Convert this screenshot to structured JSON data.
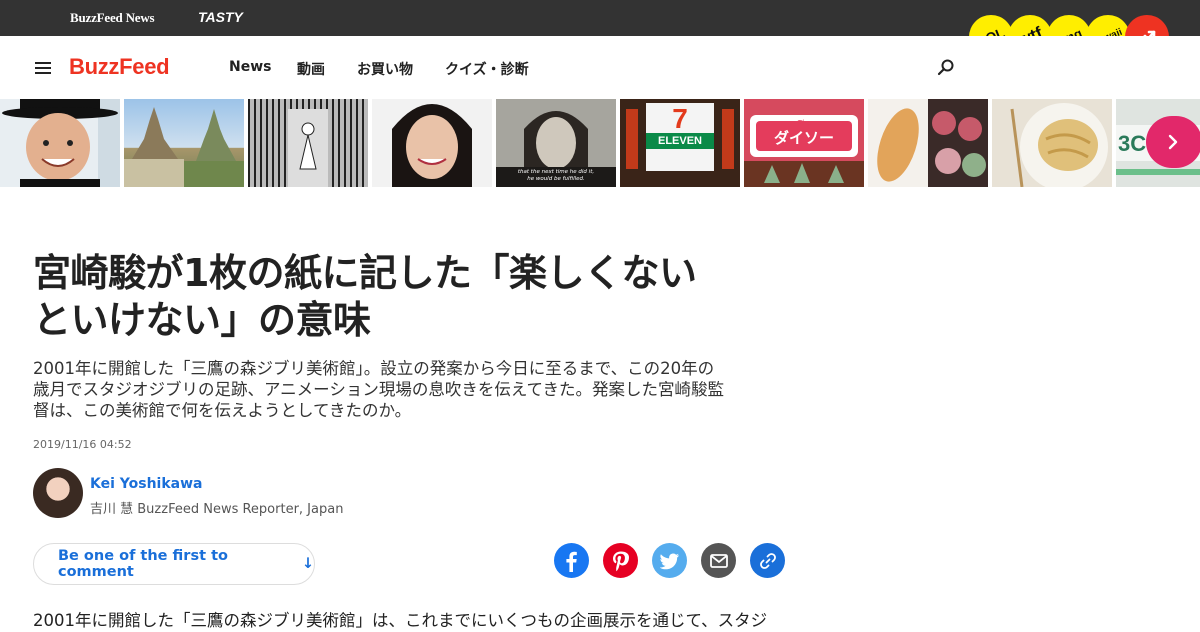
{
  "topbar": {
    "brand_primary": "BuzzFeed News",
    "brand_secondary": "TASTY"
  },
  "reactions": [
    {
      "label": "LOL"
    },
    {
      "label": "wtf"
    },
    {
      "label": "omg"
    },
    {
      "label": "kawaii"
    }
  ],
  "reaction_icons": {
    "trending": "trending-up-icon"
  },
  "nav": {
    "logo": "BuzzFeed",
    "links": [
      "News",
      "動画",
      "お買い物",
      "クイズ・診断"
    ],
    "menu_icon": "hamburger-icon",
    "search_icon": "search-icon"
  },
  "thumbnails": {
    "t5_caption_1": "that the next time he did it,",
    "t5_caption_2": "he would be fulfilled.",
    "t6_sign": "ELEVEN",
    "t6_number": "7",
    "t7_small": "The",
    "t7_sign": "ダイソー",
    "t10_text": "3CO"
  },
  "article": {
    "headline_line1": "宮崎駿が1枚の紙に記した「楽しくない",
    "headline_line2": "といけない」の意味",
    "dek_line1": "2001年に開館した「三鷹の森ジブリ美術館」。設立の発案から今日に至るまで、この20年の",
    "dek_line2": "歳月でスタジオジブリの足跡、アニメーション現場の息吹きを伝えてきた。発案した宮崎駿監",
    "dek_line3": "督は、この美術館で何を伝えようとしてきたのか。",
    "timestamp": "2019/11/16 04:52",
    "author_name": "Kei Yoshikawa",
    "author_role": "吉川 慧 BuzzFeed News Reporter, Japan",
    "comment_label": "Be one of the first to comment",
    "comment_arrow": "↓",
    "body_first_line": "2001年に開館した「三鷹の森ジブリ美術館」は、これまでにいくつもの企画展示を通じて、スタジ"
  },
  "colors": {
    "brand_red": "#ee3322",
    "link_blue": "#1a6fd9",
    "badge_yellow": "#ffee00",
    "topbar_bg": "#333333",
    "facebook": "#1877f2",
    "pinterest": "#e60023",
    "twitter": "#55acee"
  }
}
